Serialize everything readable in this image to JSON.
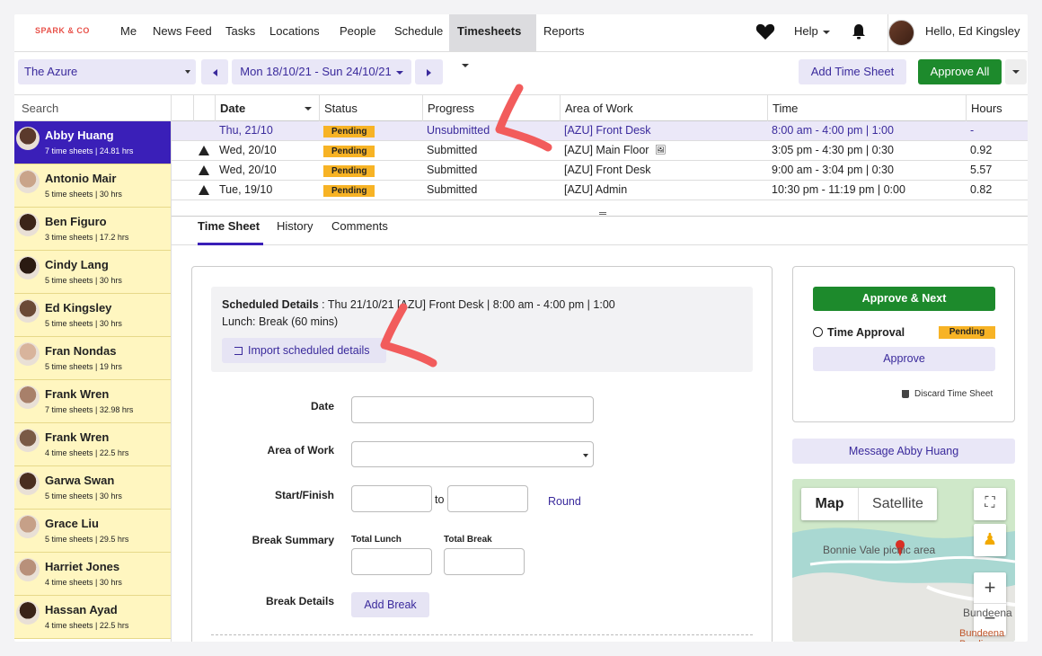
{
  "nav": {
    "logo": "SPARK & CO",
    "items": [
      "Me",
      "News Feed",
      "Tasks",
      "Locations",
      "People",
      "Schedule",
      "Timesheets",
      "Reports"
    ],
    "help": "Help",
    "greeting": "Hello, Ed Kingsley"
  },
  "toolbar": {
    "location": "The Azure",
    "date_range": "Mon 18/10/21 - Sun 24/10/21",
    "add_timesheet": "Add Time Sheet",
    "approve_all": "Approve All"
  },
  "sidebar": {
    "search_placeholder": "Search",
    "people": [
      {
        "name": "Abby Huang",
        "meta": "7 time sheets | 24.81 hrs"
      },
      {
        "name": "Antonio Mair",
        "meta": "5 time sheets | 30 hrs"
      },
      {
        "name": "Ben Figuro",
        "meta": "3 time sheets | 17.2 hrs"
      },
      {
        "name": "Cindy Lang",
        "meta": "5 time sheets | 30 hrs"
      },
      {
        "name": "Ed Kingsley",
        "meta": "5 time sheets | 30 hrs"
      },
      {
        "name": "Fran Nondas",
        "meta": "5 time sheets | 19 hrs"
      },
      {
        "name": "Frank Wren",
        "meta": "7 time sheets | 32.98 hrs"
      },
      {
        "name": "Frank Wren",
        "meta": "4 time sheets | 22.5 hrs"
      },
      {
        "name": "Garwa Swan",
        "meta": "5 time sheets | 30 hrs"
      },
      {
        "name": "Grace Liu",
        "meta": "5 time sheets | 29.5 hrs"
      },
      {
        "name": "Harriet Jones",
        "meta": "4 time sheets | 30 hrs"
      },
      {
        "name": "Hassan Ayad",
        "meta": "4 time sheets | 22.5 hrs"
      }
    ]
  },
  "table": {
    "headers": {
      "date": "Date",
      "status": "Status",
      "progress": "Progress",
      "area": "Area of Work",
      "time": "Time",
      "hours": "Hours"
    },
    "rows": [
      {
        "date": "Thu, 21/10",
        "status": "Pending",
        "progress": "Unsubmitted",
        "area": "[AZU] Front Desk",
        "time": "8:00 am - 4:00 pm | 1:00",
        "hours": "-"
      },
      {
        "date": "Wed, 20/10",
        "status": "Pending",
        "progress": "Submitted",
        "area": "[AZU] Main Floor",
        "time": "3:05 pm - 4:30 pm | 0:30",
        "hours": "0.92"
      },
      {
        "date": "Wed, 20/10",
        "status": "Pending",
        "progress": "Submitted",
        "area": "[AZU] Front Desk",
        "time": "9:00 am - 3:04 pm | 0:30",
        "hours": "5.57"
      },
      {
        "date": "Tue, 19/10",
        "status": "Pending",
        "progress": "Submitted",
        "area": "[AZU] Admin",
        "time": "10:30 pm - 11:19 pm | 0:00",
        "hours": "0.82"
      }
    ]
  },
  "tabs": [
    "Time Sheet",
    "History",
    "Comments"
  ],
  "form": {
    "sched_label": "Scheduled Details",
    "sched_value": ": Thu 21/10/21 [AZU] Front Desk | 8:00 am - 4:00 pm | 1:00",
    "lunch": "Lunch: Break (60 mins)",
    "import": "Import scheduled details",
    "date_label": "Date",
    "area_label": "Area of Work",
    "startfinish_label": "Start/Finish",
    "to": "to",
    "round": "Round",
    "break_summary_label": "Break Summary",
    "total_lunch": "Total Lunch",
    "total_break": "Total Break",
    "break_details_label": "Break Details",
    "add_break": "Add Break"
  },
  "approval": {
    "approve_next": "Approve & Next",
    "time_approval": "Time Approval",
    "status": "Pending",
    "approve": "Approve",
    "discard": "Discard Time Sheet",
    "message": "Message Abby Huang"
  },
  "map": {
    "map_tab": "Map",
    "satellite_tab": "Satellite",
    "place": "Bonnie Vale picnic area",
    "town": "Bundeena",
    "town2": "Bundeena Bowlin"
  },
  "colors": {
    "accent": "#3a1fb8",
    "approve": "#1d8a2c",
    "pending": "#f7b325",
    "annotation": "#f25c5c"
  }
}
